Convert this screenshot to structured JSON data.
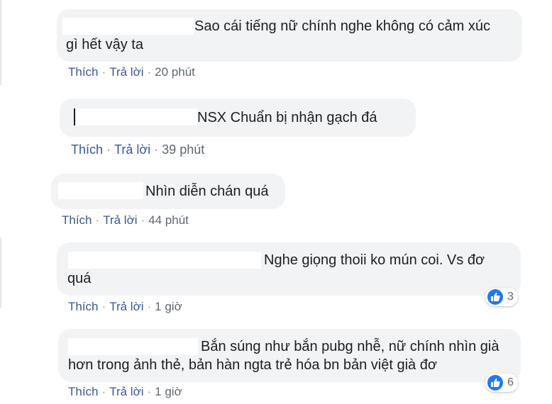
{
  "colors": {
    "bubble": "#f2f3f5",
    "link": "#385898",
    "meta": "#606770",
    "like": "#2078f4"
  },
  "icons": {
    "reaction": "thumbs-up-icon"
  },
  "comments": [
    {
      "lines": [
        "Sao cái tiếng nữ chính nghe không có cảm xúc",
        "gì hết vậy ta"
      ],
      "like": "Thích",
      "reply": "Trả lời",
      "time": "20 phút"
    },
    {
      "lines": [
        "NSX Chuẩn bị nhận gạch đá"
      ],
      "like": "Thích",
      "reply": "Trả lời",
      "time": "39 phút"
    },
    {
      "lines": [
        "Nhìn diễn chán quá"
      ],
      "like": "Thích",
      "reply": "Trả lời",
      "time": "44 phút"
    },
    {
      "lines": [
        "Nghe giọng thoii ko mún coi. Vs đơ",
        "quá"
      ],
      "like": "Thích",
      "reply": "Trả lời",
      "time": "1 giờ",
      "reactions": "3"
    },
    {
      "lines": [
        "Bắn súng như bắn pubg nhễ, nữ chính nhìn già",
        "hơn trong ảnh thẻ, bản hàn ngta trẻ hóa bn bản việt già đơ"
      ],
      "like": "Thích",
      "reply": "Trả lời",
      "time": "1 giờ",
      "reactions": "6"
    }
  ]
}
